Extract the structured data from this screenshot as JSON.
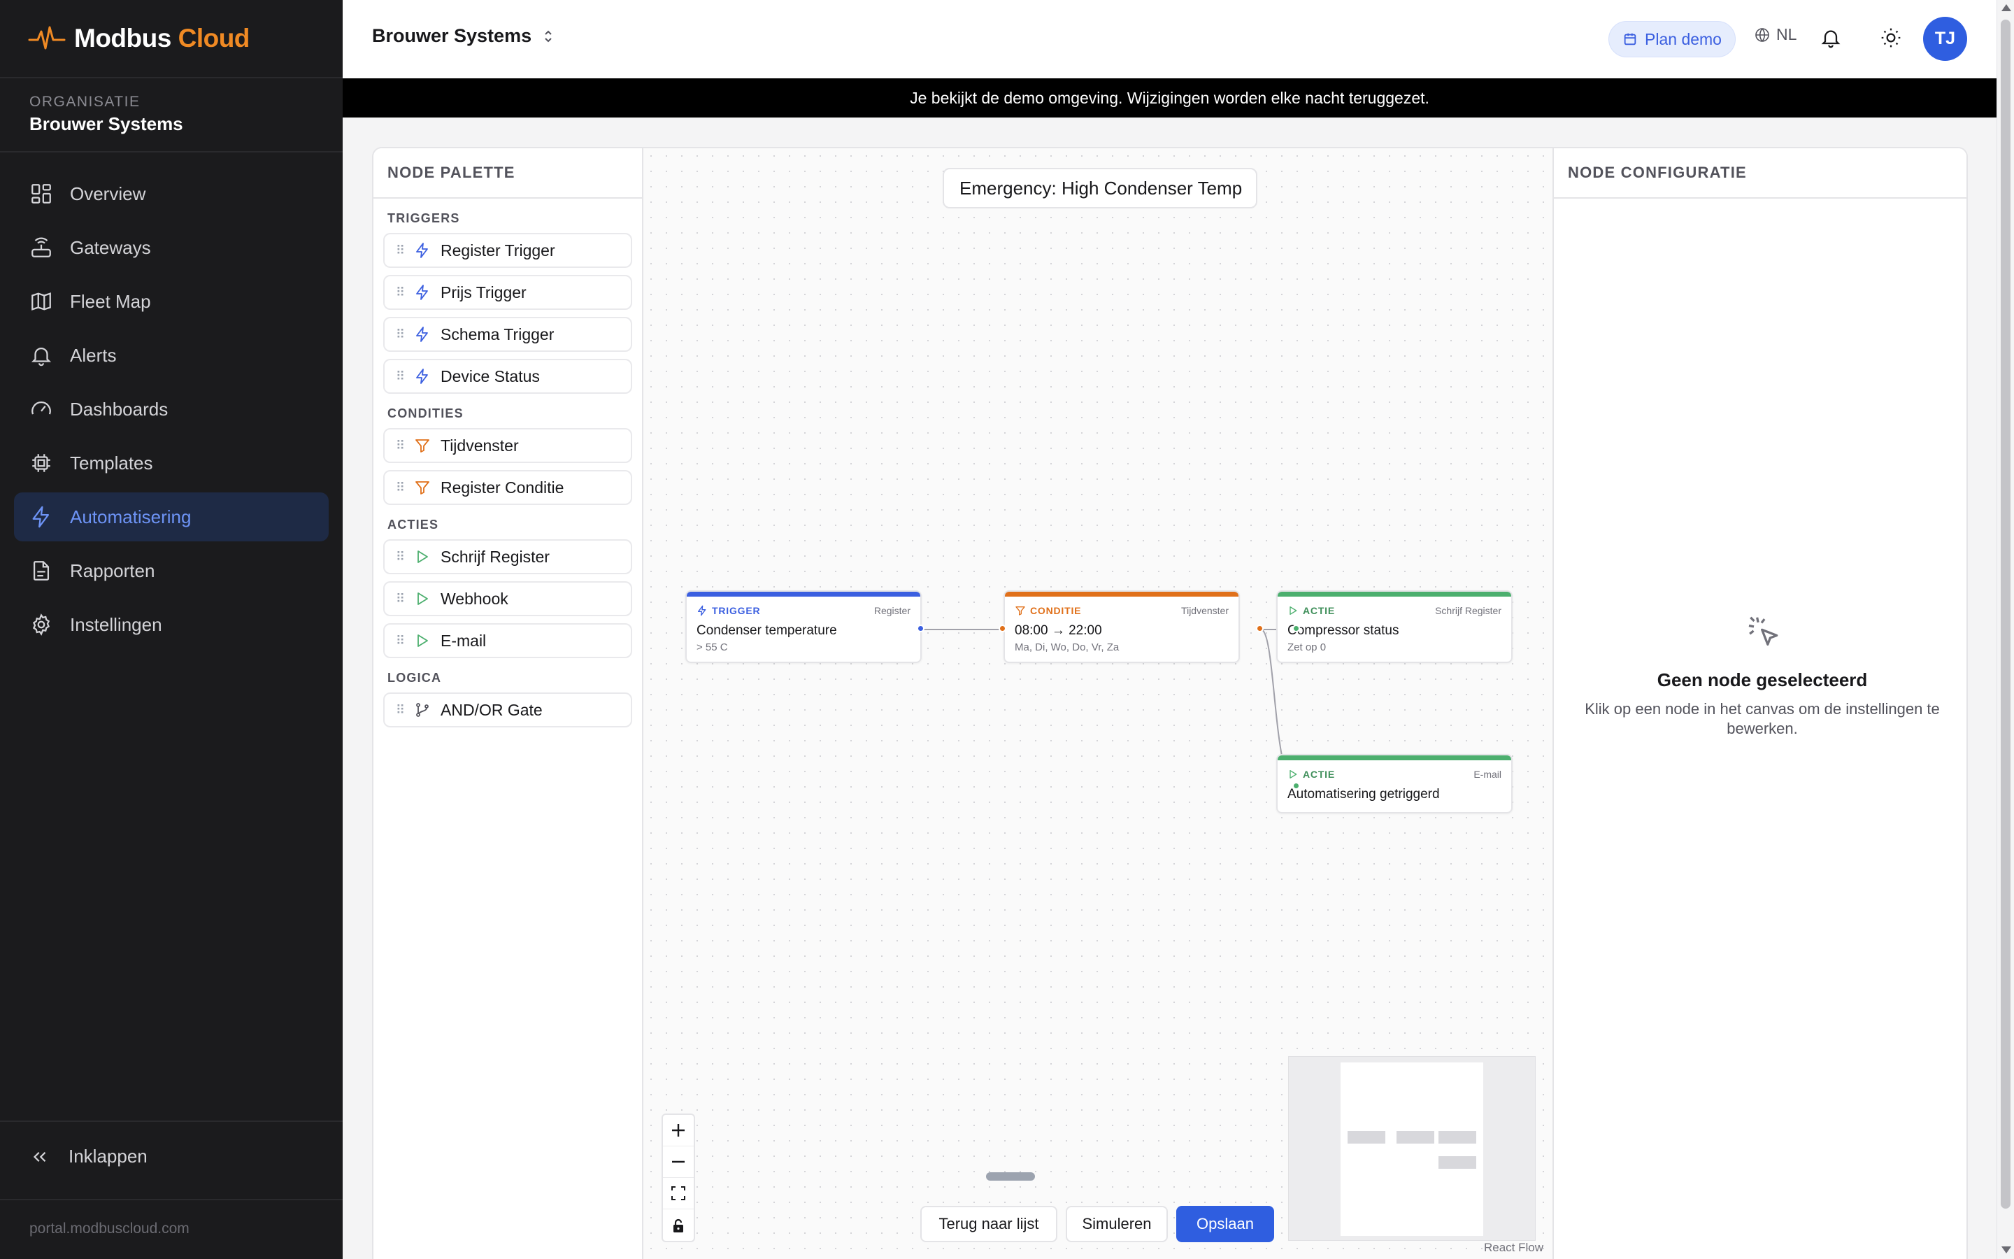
{
  "brand": {
    "name_main": "Modbus",
    "name_accent": "Cloud",
    "accent_color": "#f08a24"
  },
  "organization": {
    "label": "ORGANISATIE",
    "name": "Brouwer Systems"
  },
  "nav": {
    "items": [
      {
        "label": "Overview",
        "icon": "grid-icon",
        "active": false
      },
      {
        "label": "Gateways",
        "icon": "router-icon",
        "active": false
      },
      {
        "label": "Fleet Map",
        "icon": "map-icon",
        "active": false
      },
      {
        "label": "Alerts",
        "icon": "bell-icon",
        "active": false
      },
      {
        "label": "Dashboards",
        "icon": "gauge-icon",
        "active": false
      },
      {
        "label": "Templates",
        "icon": "chip-icon",
        "active": false
      },
      {
        "label": "Automatisering",
        "icon": "lightning-icon",
        "active": true
      },
      {
        "label": "Rapporten",
        "icon": "file-icon",
        "active": false
      },
      {
        "label": "Instellingen",
        "icon": "gear-icon",
        "active": false
      }
    ],
    "collapse_label": "Inklappen",
    "footer_url": "portal.modbuscloud.com"
  },
  "topbar": {
    "org_switcher": "Brouwer Systems",
    "plan_demo": "Plan demo",
    "language": "NL",
    "avatar_initials": "TJ"
  },
  "banner": "Je bekijkt de demo omgeving. Wijzigingen worden elke nacht teruggezet.",
  "palette": {
    "title": "NODE PALETTE",
    "sections": [
      {
        "label": "TRIGGERS",
        "items": [
          "Register Trigger",
          "Prijs Trigger",
          "Schema Trigger",
          "Device Status"
        ]
      },
      {
        "label": "CONDITIES",
        "items": [
          "Tijdvenster",
          "Register Conditie"
        ]
      },
      {
        "label": "ACTIES",
        "items": [
          "Schrijf Register",
          "Webhook",
          "E-mail"
        ]
      },
      {
        "label": "LOGICA",
        "items": [
          "AND/OR Gate"
        ]
      }
    ]
  },
  "canvas": {
    "automation_name": "Emergency: High Condenser Temp",
    "nodes": {
      "trigger": {
        "kind": "TRIGGER",
        "sub": "Register",
        "title": "Condenser temperature",
        "desc": "> 55 C",
        "color": "#3b5fe0"
      },
      "condition": {
        "kind": "CONDITIE",
        "sub": "Tijdvenster",
        "title": "08:00 → 22:00",
        "desc": "Ma, Di, Wo, Do, Vr, Za",
        "color": "#e0701a"
      },
      "action1": {
        "kind": "ACTIE",
        "sub": "Schrijf Register",
        "title": "Compressor status",
        "desc": "Zet op 0",
        "color": "#4caf6e"
      },
      "action2": {
        "kind": "ACTIE",
        "sub": "E-mail",
        "title": "Automatisering getriggerd",
        "desc": "",
        "color": "#4caf6e"
      }
    },
    "buttons": {
      "back": "Terug naar lijst",
      "simulate": "Simuleren",
      "save": "Opslaan"
    },
    "attribution": "React Flow"
  },
  "config": {
    "title": "NODE CONFIGURATIE",
    "empty_title": "Geen node geselecteerd",
    "empty_text": "Klik op een node in het canvas om de instellingen te bewerken."
  }
}
